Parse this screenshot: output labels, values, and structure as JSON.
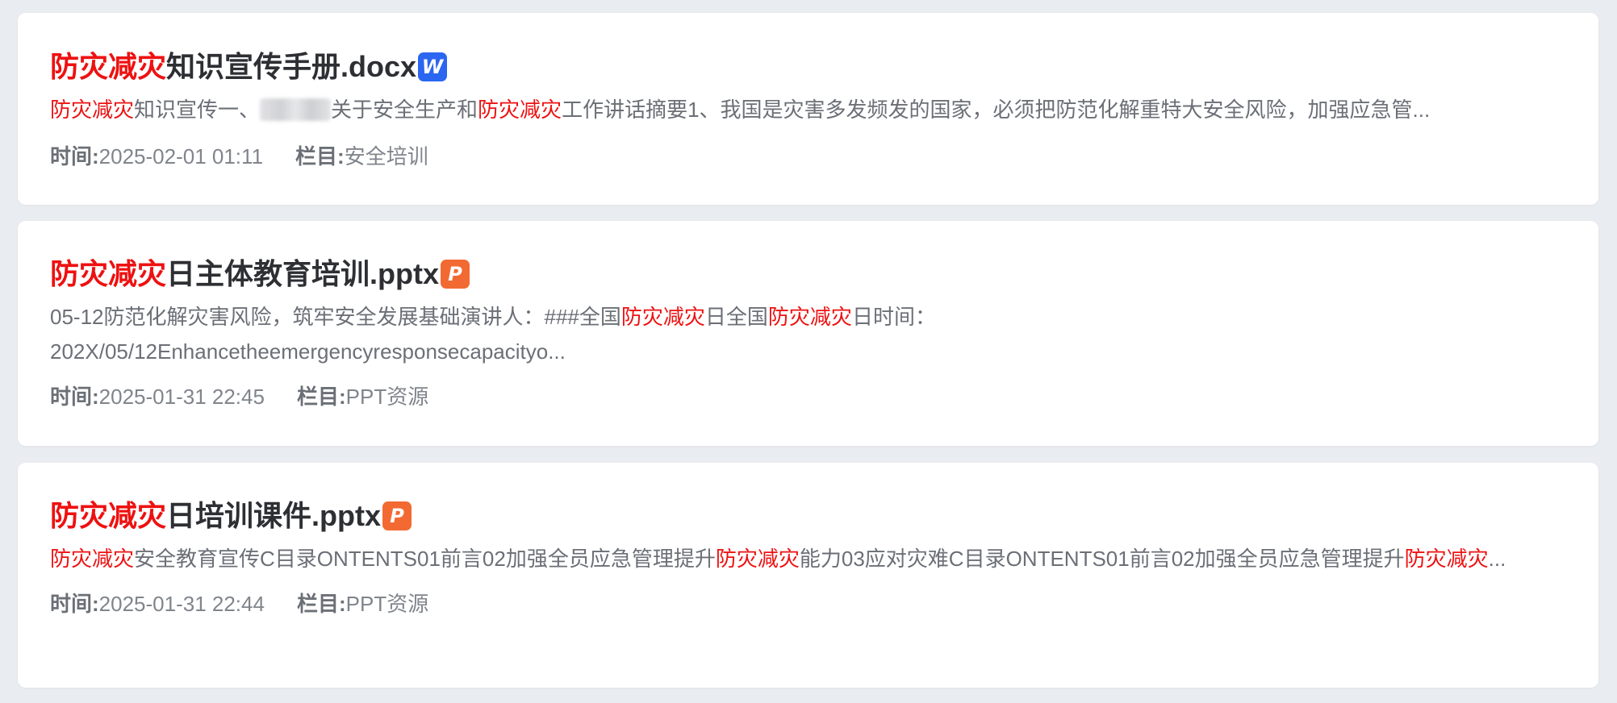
{
  "results": [
    {
      "title_highlight": "防灾减灾",
      "title_rest": "知识宣传手册.docx",
      "file_type": "word",
      "icon_letter": "W",
      "snippet": {
        "hl1": "防灾减灾",
        "t1": "知识宣传一、",
        "t2": "关于安全生产和",
        "hl2": "防灾减灾",
        "t3": "工作讲话摘要1、我国是灾害多发频发的国家，必须把防范化解重特大安全风险，加强应急管..."
      },
      "time_label": "时间:",
      "time_value": "2025-02-01 01:11",
      "column_label": "栏目:",
      "column_value": "安全培训"
    },
    {
      "title_highlight": "防灾减灾",
      "title_rest": "日主体教育培训.pptx",
      "file_type": "ppt",
      "icon_letter": "P",
      "snippet": {
        "t1": "05-12防范化解灾害风险，筑牢安全发展基础演讲人：###全国",
        "hl1": "防灾减灾",
        "t2": "日全国",
        "hl2": "防灾减灾",
        "t3": "日时间：",
        "t4": "202X/05/12Enhancetheemergencyresponsecapacityo..."
      },
      "time_label": "时间:",
      "time_value": "2025-01-31 22:45",
      "column_label": "栏目:",
      "column_value": "PPT资源"
    },
    {
      "title_highlight": "防灾减灾",
      "title_rest": "日培训课件.pptx",
      "file_type": "ppt",
      "icon_letter": "P",
      "snippet": {
        "hl1": "防灾减灾",
        "t1": "安全教育宣传C目录ONTENTS01前言02加强全员应急管理提升",
        "hl2": "防灾减灾",
        "t2": "能力03应对灾难C目录ONTENTS01前言02加强全员应急管理提升",
        "hl3": "防灾减灾",
        "t3": "..."
      },
      "time_label": "时间:",
      "time_value": "2025-01-31 22:44",
      "column_label": "栏目:",
      "column_value": "PPT资源"
    }
  ],
  "colors": {
    "page_background": "#e9ecf0",
    "card_background": "#ffffff",
    "highlight": "#ee1111",
    "title_text": "#2d2f33",
    "snippet_text": "#6b6f76",
    "meta_text": "#80858c",
    "word_icon": "#2b66f0",
    "ppt_icon": "#f26a32"
  }
}
